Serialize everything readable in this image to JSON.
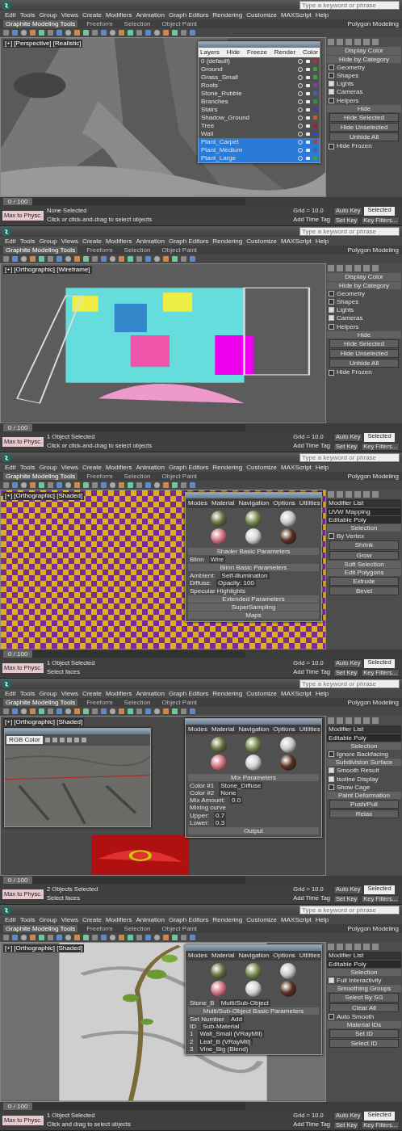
{
  "screens": [
    {
      "search": {
        "placeholder": "Type a keyword or phrase"
      },
      "menus": [
        "Edit",
        "Tools",
        "Group",
        "Views",
        "Create",
        "Modifiers",
        "Animation",
        "Graph Editors",
        "Rendering",
        "Customize",
        "MAXScript",
        "Help"
      ],
      "ribbon_tabs": [
        {
          "label": "Graphite Modeling Tools",
          "selected": true
        },
        {
          "label": "Freeform",
          "selected": false
        },
        {
          "label": "Selection",
          "selected": false
        },
        {
          "label": "Object Paint",
          "selected": false
        }
      ],
      "ribbon_panel": "Polygon Modeling",
      "viewport": {
        "label": "[+] [Perspective] [Realistic]",
        "kind": "tree"
      },
      "dialogs": [
        {
          "kind": "layers",
          "columns": [
            "Layers",
            "Hide",
            "Freeze",
            "Render",
            "Color"
          ],
          "rows": [
            {
              "name": "0 (default)",
              "selected": false,
              "color": "#b03040"
            },
            {
              "name": "Ground",
              "selected": false,
              "color": "#40a040"
            },
            {
              "name": "Grass_Small",
              "selected": false,
              "color": "#40a040"
            },
            {
              "name": "Roots",
              "selected": false,
              "color": "#8040a0"
            },
            {
              "name": "Stone_Rubble",
              "selected": false,
              "color": "#4060b0"
            },
            {
              "name": "Branches",
              "selected": false,
              "color": "#2f8f4f"
            },
            {
              "name": "Stairs",
              "selected": false,
              "color": "#4040a0"
            },
            {
              "name": "Shadow_Ground",
              "selected": false,
              "color": "#c06030"
            },
            {
              "name": "Tree",
              "selected": false,
              "color": "#a02030"
            },
            {
              "name": "Wall",
              "selected": false,
              "color": "#4040b0"
            },
            {
              "name": "Plant_Carpet",
              "selected": true,
              "color": "#b04030"
            },
            {
              "name": "Plant_Medium",
              "selected": true,
              "color": "#4060b0"
            },
            {
              "name": "Plant_Large",
              "selected": true,
              "color": "#40a040"
            }
          ]
        }
      ],
      "command_panel": {
        "items": [
          {
            "kind": "heading",
            "text": "Display Color"
          },
          {
            "kind": "heading",
            "text": "Hide by Category"
          },
          {
            "kind": "check",
            "text": "Geometry",
            "checked": false
          },
          {
            "kind": "check",
            "text": "Shapes",
            "checked": false
          },
          {
            "kind": "check",
            "text": "Lights",
            "checked": true
          },
          {
            "kind": "check",
            "text": "Cameras",
            "checked": true
          },
          {
            "kind": "check",
            "text": "Helpers",
            "checked": false
          },
          {
            "kind": "heading",
            "text": "Hide"
          },
          {
            "kind": "button",
            "text": "Hide Selected"
          },
          {
            "kind": "button",
            "text": "Hide Unselected"
          },
          {
            "kind": "button",
            "text": "Unhide All"
          },
          {
            "kind": "check",
            "text": "Hide Frozen",
            "checked": false
          }
        ]
      },
      "timeline": {
        "frame": "0 / 100",
        "level": 0
      },
      "status": {
        "script": "Max to Physc.",
        "selection": "None Selected",
        "prompt": "Click or click-and-drag to select objects",
        "grid": "Grid = 10.0",
        "time_tag": "Add Time Tag",
        "auto_key": "Auto Key",
        "key_mode": "Selected",
        "set_key": "Set Key",
        "key_filters": "Key Filters..."
      }
    },
    {
      "search": {
        "placeholder": "Type a keyword or phrase"
      },
      "menus": [
        "Edit",
        "Tools",
        "Group",
        "Views",
        "Create",
        "Modifiers",
        "Animation",
        "Graph Editors",
        "Rendering",
        "Customize",
        "MAXScript",
        "Help"
      ],
      "ribbon_tabs": [
        {
          "label": "Graphite Modeling Tools",
          "selected": true
        },
        {
          "label": "Freeform",
          "selected": false
        },
        {
          "label": "Selection",
          "selected": false
        },
        {
          "label": "Object Paint",
          "selected": false
        }
      ],
      "ribbon_panel": "Polygon Modeling",
      "viewport": {
        "label": "[+] [Orthographic] [Wireframe]",
        "kind": "wireframe"
      },
      "command_panel": {
        "items": [
          {
            "kind": "heading",
            "text": "Display Color"
          },
          {
            "kind": "heading",
            "text": "Hide by Category"
          },
          {
            "kind": "check",
            "text": "Geometry",
            "checked": false
          },
          {
            "kind": "check",
            "text": "Shapes",
            "checked": false
          },
          {
            "kind": "check",
            "text": "Lights",
            "checked": true
          },
          {
            "kind": "check",
            "text": "Cameras",
            "checked": true
          },
          {
            "kind": "check",
            "text": "Helpers",
            "checked": false
          },
          {
            "kind": "heading",
            "text": "Hide"
          },
          {
            "kind": "button",
            "text": "Hide Selected"
          },
          {
            "kind": "button",
            "text": "Hide Unselected"
          },
          {
            "kind": "button",
            "text": "Unhide All"
          },
          {
            "kind": "check",
            "text": "Hide Frozen",
            "checked": false
          }
        ]
      },
      "timeline": {
        "frame": "0 / 100",
        "level": 0
      },
      "status": {
        "script": "Max to Physc.",
        "selection": "1 Object Selected",
        "prompt": "Click or click-and-drag to select objects",
        "grid": "Grid = 10.0",
        "time_tag": "Add Time Tag",
        "auto_key": "Auto Key",
        "key_mode": "Selected",
        "set_key": "Set Key",
        "key_filters": "Key Filters..."
      }
    },
    {
      "search": {
        "placeholder": "Type a keyword or phrase"
      },
      "menus": [
        "Edit",
        "Tools",
        "Group",
        "Views",
        "Create",
        "Modifiers",
        "Animation",
        "Graph Editors",
        "Rendering",
        "Customize",
        "MAXScript",
        "Help"
      ],
      "ribbon_tabs": [
        {
          "label": "Graphite Modeling Tools",
          "selected": true
        },
        {
          "label": "Freeform",
          "selected": false
        },
        {
          "label": "Selection",
          "selected": false
        },
        {
          "label": "Object Paint",
          "selected": false
        }
      ],
      "ribbon_panel": "Polygon Modeling",
      "viewport": {
        "label": "[+] [Orthographic] [Shaded]",
        "kind": "checker"
      },
      "dialogs": [
        {
          "kind": "material",
          "menus": [
            "Modes",
            "Material",
            "Navigation",
            "Options",
            "Utilities"
          ],
          "lines": [
            {
              "kind": "heading",
              "text": "Shader Basic Parameters"
            },
            {
              "kind": "pair",
              "text": "Blinn",
              "value": "Wire"
            },
            {
              "kind": "heading",
              "text": "Blinn Basic Parameters"
            },
            {
              "kind": "pair",
              "text": "Ambient:",
              "value": "Self-Illumination"
            },
            {
              "kind": "pair",
              "text": "Diffuse:",
              "value": "Opacity: 100"
            },
            {
              "kind": "text",
              "text": "Specular Highlights"
            },
            {
              "kind": "heading",
              "text": "Extended Parameters"
            },
            {
              "kind": "heading",
              "text": "SuperSampling"
            },
            {
              "kind": "heading",
              "text": "Maps"
            }
          ]
        }
      ],
      "command_panel": {
        "items": [
          {
            "kind": "field",
            "text": "Modifier List"
          },
          {
            "kind": "list",
            "text": "UVW Mapping"
          },
          {
            "kind": "list",
            "text": "Editable Poly"
          },
          {
            "kind": "heading",
            "text": "Selection"
          },
          {
            "kind": "check",
            "text": "By Vertex",
            "checked": false
          },
          {
            "kind": "button",
            "text": "Shrink"
          },
          {
            "kind": "button",
            "text": "Grow"
          },
          {
            "kind": "heading",
            "text": "Soft Selection"
          },
          {
            "kind": "heading",
            "text": "Edit Polygons"
          },
          {
            "kind": "button",
            "text": "Extrude"
          },
          {
            "kind": "button",
            "text": "Bevel"
          }
        ]
      },
      "timeline": {
        "frame": "0 / 100",
        "level": 0
      },
      "status": {
        "script": "Max to Physc.",
        "selection": "1 Object Selected",
        "prompt": "Select faces",
        "grid": "Grid = 10.0",
        "time_tag": "Add Time Tag",
        "auto_key": "Auto Key",
        "key_mode": "Selected",
        "set_key": "Set Key",
        "key_filters": "Key Filters..."
      }
    },
    {
      "search": {
        "placeholder": "Type a keyword or phrase"
      },
      "menus": [
        "Edit",
        "Tools",
        "Group",
        "Views",
        "Create",
        "Modifiers",
        "Animation",
        "Graph Editors",
        "Rendering",
        "Customize",
        "MAXScript",
        "Help"
      ],
      "ribbon_tabs": [
        {
          "label": "Graphite Modeling Tools",
          "selected": true
        },
        {
          "label": "Freeform",
          "selected": false
        },
        {
          "label": "Selection",
          "selected": false
        },
        {
          "label": "Object Paint",
          "selected": false
        }
      ],
      "ribbon_panel": "Polygon Modeling",
      "viewport": {
        "label": "[+] [Orthographic] [Shaded]",
        "kind": "stone"
      },
      "dialogs": [
        {
          "kind": "frame",
          "field": "RGB Color"
        },
        {
          "kind": "material",
          "menus": [
            "Modes",
            "Material",
            "Navigation",
            "Options",
            "Utilities"
          ],
          "lines": [
            {
              "kind": "heading",
              "text": "Mix Parameters"
            },
            {
              "kind": "pair",
              "text": "Color #1",
              "value": "Stone_Diffuse"
            },
            {
              "kind": "pair",
              "text": "Color #2",
              "value": "None"
            },
            {
              "kind": "pair",
              "text": "Mix Amount:",
              "value": "0.0"
            },
            {
              "kind": "text",
              "text": "Mixing curve"
            },
            {
              "kind": "pair",
              "text": "Upper:",
              "value": "0.7"
            },
            {
              "kind": "pair",
              "text": "Lower:",
              "value": "0.3"
            },
            {
              "kind": "heading",
              "text": "Output"
            }
          ]
        }
      ],
      "command_panel": {
        "items": [
          {
            "kind": "field",
            "text": "Modifier List"
          },
          {
            "kind": "list",
            "text": "Editable Poly"
          },
          {
            "kind": "heading",
            "text": "Selection"
          },
          {
            "kind": "check",
            "text": "Ignore Backfacing",
            "checked": false
          },
          {
            "kind": "heading",
            "text": "Subdivision Surface"
          },
          {
            "kind": "check",
            "text": "Smooth Result",
            "checked": true
          },
          {
            "kind": "check",
            "text": "Isoline Display",
            "checked": true
          },
          {
            "kind": "check",
            "text": "Show Cage",
            "checked": false
          },
          {
            "kind": "heading",
            "text": "Paint Deformation"
          },
          {
            "kind": "button",
            "text": "Push/Pull"
          },
          {
            "kind": "button",
            "text": "Relax"
          }
        ]
      },
      "timeline": {
        "frame": "0 / 100",
        "level": 0
      },
      "status": {
        "script": "Max to Physc.",
        "selection": "2 Objects Selected",
        "prompt": "Select faces",
        "grid": "Grid = 10.0",
        "time_tag": "Add Time Tag",
        "auto_key": "Auto Key",
        "key_mode": "Selected",
        "set_key": "Set Key",
        "key_filters": "Key Filters..."
      }
    },
    {
      "search": {
        "placeholder": "Type a keyword or phrase"
      },
      "menus": [
        "Edit",
        "Tools",
        "Group",
        "Views",
        "Create",
        "Modifiers",
        "Animation",
        "Graph Editors",
        "Rendering",
        "Customize",
        "MAXScript",
        "Help"
      ],
      "ribbon_tabs": [
        {
          "label": "Graphite Modeling Tools",
          "selected": true
        },
        {
          "label": "Freeform",
          "selected": false
        },
        {
          "label": "Selection",
          "selected": false
        },
        {
          "label": "Object Paint",
          "selected": false
        }
      ],
      "ribbon_panel": "Polygon Modeling",
      "viewport": {
        "label": "[+] [Orthographic] [Shaded]",
        "kind": "relief"
      },
      "dialogs": [
        {
          "kind": "material",
          "menus": [
            "Modes",
            "Material",
            "Navigation",
            "Options",
            "Utilities"
          ],
          "lines": [
            {
              "kind": "pair",
              "text": "Stone_B",
              "value": "Multi/Sub-Object"
            },
            {
              "kind": "heading",
              "text": "Multi/Sub-Object Basic Parameters"
            },
            {
              "kind": "pair",
              "text": "Set Number",
              "value": "Add"
            },
            {
              "kind": "pair",
              "text": "ID",
              "value": "Sub-Material"
            },
            {
              "kind": "pair",
              "text": "1",
              "value": "Wall_Small (VRayMtl)"
            },
            {
              "kind": "pair",
              "text": "2",
              "value": "Leaf_B (VRayMtl)"
            },
            {
              "kind": "pair",
              "text": "3",
              "value": "Vine_Big (Blend)"
            }
          ]
        }
      ],
      "command_panel": {
        "items": [
          {
            "kind": "field",
            "text": "Modifier List"
          },
          {
            "kind": "list",
            "text": "Editable Poly"
          },
          {
            "kind": "heading",
            "text": "Selection"
          },
          {
            "kind": "check",
            "text": "Full Interactivity",
            "checked": true
          },
          {
            "kind": "heading",
            "text": "Smoothing Groups"
          },
          {
            "kind": "button",
            "text": "Select By SG"
          },
          {
            "kind": "button",
            "text": "Clear All"
          },
          {
            "kind": "check",
            "text": "Auto Smooth",
            "checked": false
          },
          {
            "kind": "heading",
            "text": "Material IDs"
          },
          {
            "kind": "button",
            "text": "Set ID"
          },
          {
            "kind": "button",
            "text": "Select ID"
          }
        ]
      },
      "timeline": {
        "frame": "0 / 100",
        "level": 0
      },
      "status": {
        "script": "Max to Physc.",
        "selection": "1 Object Selected",
        "prompt": "Click and drag to select objects",
        "grid": "Grid = 10.0",
        "time_tag": "Add Time Tag",
        "auto_key": "Auto Key",
        "key_mode": "Selected",
        "set_key": "Set Key",
        "key_filters": "Key Filters..."
      }
    }
  ]
}
